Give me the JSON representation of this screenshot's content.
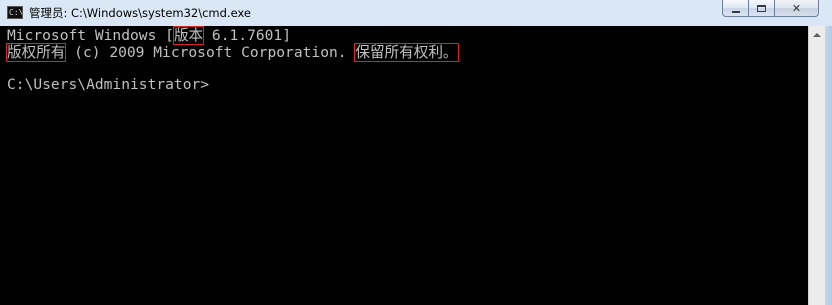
{
  "window": {
    "title": "管理员: C:\\Windows\\system32\\cmd.exe",
    "icon": "cmd-console-icon",
    "icon_text": "C:\\",
    "buttons": {
      "minimize": "minimize-icon",
      "maximize": "maximize-icon",
      "close": "✕"
    }
  },
  "console": {
    "line1": {
      "before": "Microsoft Windows [",
      "highlight": "版本",
      "after": " 6.1.7601]"
    },
    "line2": {
      "highlight1": "版权所有",
      "middle": " (c) 2009 Microsoft Corporation.",
      "highlight2": "保留所有权利。"
    },
    "prompt": "C:\\Users\\Administrator>"
  },
  "colors": {
    "console_bg": "#000000",
    "console_text": "#c0c0c0",
    "highlight_box": "#e0211d"
  }
}
